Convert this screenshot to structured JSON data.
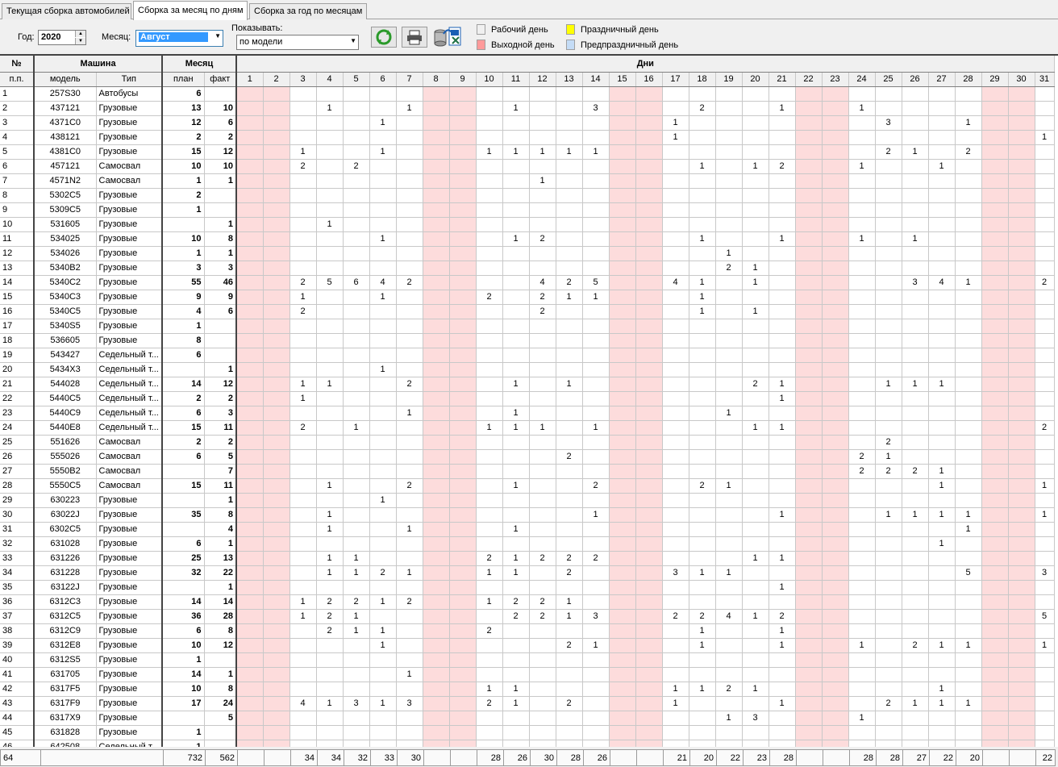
{
  "tabs": [
    {
      "label": "Текущая сборка автомобилей",
      "active": false
    },
    {
      "label": "Сборка за месяц по дням",
      "active": true
    },
    {
      "label": "Сборка за год по месяцам",
      "active": false
    }
  ],
  "toolbar": {
    "year_label": "Год:",
    "year_value": "2020",
    "month_label": "Месяц:",
    "month_value": "Август",
    "show_label": "Показывать:",
    "show_value": "по модели"
  },
  "legend": {
    "work": "Рабочий день",
    "holiday": "Праздничный день",
    "weekend": "Выходной день",
    "preholiday": "Предпраздничный день",
    "colors": {
      "work": "#ffffff",
      "holiday": "#ffff00",
      "weekend": "#ff9a9a",
      "preholiday": "#c4dcf6"
    }
  },
  "headers": {
    "num": "№",
    "machine": "Машина",
    "month": "Месяц",
    "days": "Дни",
    "pp": "п.п.",
    "model": "модель",
    "type": "Тип",
    "plan": "план",
    "fact": "факт"
  },
  "days": [
    "1",
    "2",
    "3",
    "4",
    "5",
    "6",
    "7",
    "8",
    "9",
    "10",
    "11",
    "12",
    "13",
    "14",
    "15",
    "16",
    "17",
    "18",
    "19",
    "20",
    "21",
    "22",
    "23",
    "24",
    "25",
    "26",
    "27",
    "28",
    "29",
    "30",
    "31"
  ],
  "weekend_days": [
    1,
    2,
    8,
    9,
    15,
    16,
    22,
    23,
    29,
    30
  ],
  "rows": [
    {
      "n": "1",
      "model": "257S30",
      "type": "Автобусы",
      "plan": "6",
      "fact": "",
      "d": {}
    },
    {
      "n": "2",
      "model": "437121",
      "type": "Грузовые",
      "plan": "13",
      "fact": "10",
      "d": {
        "4": "1",
        "7": "1",
        "11": "1",
        "14": "3",
        "18": "2",
        "21": "1",
        "24": "1"
      }
    },
    {
      "n": "3",
      "model": "4371C0",
      "type": "Грузовые",
      "plan": "12",
      "fact": "6",
      "d": {
        "6": "1",
        "17": "1",
        "25": "3",
        "28": "1"
      }
    },
    {
      "n": "4",
      "model": "438121",
      "type": "Грузовые",
      "plan": "2",
      "fact": "2",
      "d": {
        "17": "1",
        "31": "1"
      }
    },
    {
      "n": "5",
      "model": "4381C0",
      "type": "Грузовые",
      "plan": "15",
      "fact": "12",
      "d": {
        "3": "1",
        "6": "1",
        "10": "1",
        "11": "1",
        "12": "1",
        "13": "1",
        "14": "1",
        "25": "2",
        "26": "1",
        "28": "2"
      }
    },
    {
      "n": "6",
      "model": "457121",
      "type": "Самосвал",
      "plan": "10",
      "fact": "10",
      "d": {
        "3": "2",
        "5": "2",
        "18": "1",
        "20": "1",
        "21": "2",
        "24": "1",
        "27": "1"
      }
    },
    {
      "n": "7",
      "model": "4571N2",
      "type": "Самосвал",
      "plan": "1",
      "fact": "1",
      "d": {
        "12": "1"
      }
    },
    {
      "n": "8",
      "model": "5302C5",
      "type": "Грузовые",
      "plan": "2",
      "fact": "",
      "d": {}
    },
    {
      "n": "9",
      "model": "5309C5",
      "type": "Грузовые",
      "plan": "1",
      "fact": "",
      "d": {}
    },
    {
      "n": "10",
      "model": "531605",
      "type": "Грузовые",
      "plan": "",
      "fact": "1",
      "d": {
        "4": "1"
      }
    },
    {
      "n": "11",
      "model": "534025",
      "type": "Грузовые",
      "plan": "10",
      "fact": "8",
      "d": {
        "6": "1",
        "11": "1",
        "12": "2",
        "18": "1",
        "21": "1",
        "24": "1",
        "26": "1"
      }
    },
    {
      "n": "12",
      "model": "534026",
      "type": "Грузовые",
      "plan": "1",
      "fact": "1",
      "d": {
        "19": "1"
      }
    },
    {
      "n": "13",
      "model": "5340B2",
      "type": "Грузовые",
      "plan": "3",
      "fact": "3",
      "d": {
        "19": "2",
        "20": "1"
      }
    },
    {
      "n": "14",
      "model": "5340C2",
      "type": "Грузовые",
      "plan": "55",
      "fact": "46",
      "d": {
        "3": "2",
        "4": "5",
        "5": "6",
        "6": "4",
        "7": "2",
        "12": "4",
        "13": "2",
        "14": "5",
        "17": "4",
        "18": "1",
        "20": "1",
        "26": "3",
        "27": "4",
        "28": "1",
        "31": "2"
      }
    },
    {
      "n": "15",
      "model": "5340C3",
      "type": "Грузовые",
      "plan": "9",
      "fact": "9",
      "d": {
        "3": "1",
        "6": "1",
        "10": "2",
        "12": "2",
        "13": "1",
        "14": "1",
        "18": "1"
      }
    },
    {
      "n": "16",
      "model": "5340C5",
      "type": "Грузовые",
      "plan": "4",
      "fact": "6",
      "d": {
        "3": "2",
        "12": "2",
        "18": "1",
        "20": "1"
      }
    },
    {
      "n": "17",
      "model": "5340S5",
      "type": "Грузовые",
      "plan": "1",
      "fact": "",
      "d": {}
    },
    {
      "n": "18",
      "model": "536605",
      "type": "Грузовые",
      "plan": "8",
      "fact": "",
      "d": {}
    },
    {
      "n": "19",
      "model": "543427",
      "type": "Седельный т...",
      "plan": "6",
      "fact": "",
      "d": {}
    },
    {
      "n": "20",
      "model": "5434X3",
      "type": "Седельный т...",
      "plan": "",
      "fact": "1",
      "d": {
        "6": "1"
      }
    },
    {
      "n": "21",
      "model": "544028",
      "type": "Седельный т...",
      "plan": "14",
      "fact": "12",
      "d": {
        "3": "1",
        "4": "1",
        "7": "2",
        "11": "1",
        "13": "1",
        "20": "2",
        "21": "1",
        "25": "1",
        "26": "1",
        "27": "1"
      }
    },
    {
      "n": "22",
      "model": "5440C5",
      "type": "Седельный т...",
      "plan": "2",
      "fact": "2",
      "d": {
        "3": "1",
        "21": "1"
      }
    },
    {
      "n": "23",
      "model": "5440C9",
      "type": "Седельный т...",
      "plan": "6",
      "fact": "3",
      "d": {
        "7": "1",
        "11": "1",
        "19": "1"
      }
    },
    {
      "n": "24",
      "model": "5440E8",
      "type": "Седельный т...",
      "plan": "15",
      "fact": "11",
      "d": {
        "3": "2",
        "5": "1",
        "10": "1",
        "11": "1",
        "12": "1",
        "14": "1",
        "20": "1",
        "21": "1",
        "31": "2"
      }
    },
    {
      "n": "25",
      "model": "551626",
      "type": "Самосвал",
      "plan": "2",
      "fact": "2",
      "d": {
        "25": "2"
      }
    },
    {
      "n": "26",
      "model": "555026",
      "type": "Самосвал",
      "plan": "6",
      "fact": "5",
      "d": {
        "13": "2",
        "24": "2",
        "25": "1"
      }
    },
    {
      "n": "27",
      "model": "5550B2",
      "type": "Самосвал",
      "plan": "",
      "fact": "7",
      "d": {
        "24": "2",
        "25": "2",
        "26": "2",
        "27": "1"
      }
    },
    {
      "n": "28",
      "model": "5550C5",
      "type": "Самосвал",
      "plan": "15",
      "fact": "11",
      "d": {
        "4": "1",
        "7": "2",
        "11": "1",
        "14": "2",
        "18": "2",
        "19": "1",
        "27": "1",
        "31": "1"
      }
    },
    {
      "n": "29",
      "model": "630223",
      "type": "Грузовые",
      "plan": "",
      "fact": "1",
      "d": {
        "6": "1"
      }
    },
    {
      "n": "30",
      "model": "63022J",
      "type": "Грузовые",
      "plan": "35",
      "fact": "8",
      "d": {
        "4": "1",
        "14": "1",
        "21": "1",
        "25": "1",
        "26": "1",
        "27": "1",
        "28": "1",
        "31": "1"
      }
    },
    {
      "n": "31",
      "model": "6302C5",
      "type": "Грузовые",
      "plan": "",
      "fact": "4",
      "d": {
        "4": "1",
        "7": "1",
        "11": "1",
        "28": "1"
      }
    },
    {
      "n": "32",
      "model": "631028",
      "type": "Грузовые",
      "plan": "6",
      "fact": "1",
      "d": {
        "27": "1"
      }
    },
    {
      "n": "33",
      "model": "631226",
      "type": "Грузовые",
      "plan": "25",
      "fact": "13",
      "d": {
        "4": "1",
        "5": "1",
        "10": "2",
        "11": "1",
        "12": "2",
        "13": "2",
        "14": "2",
        "20": "1",
        "21": "1"
      }
    },
    {
      "n": "34",
      "model": "631228",
      "type": "Грузовые",
      "plan": "32",
      "fact": "22",
      "d": {
        "4": "1",
        "5": "1",
        "6": "2",
        "7": "1",
        "10": "1",
        "11": "1",
        "13": "2",
        "17": "3",
        "18": "1",
        "19": "1",
        "28": "5",
        "31": "3"
      }
    },
    {
      "n": "35",
      "model": "63122J",
      "type": "Грузовые",
      "plan": "",
      "fact": "1",
      "d": {
        "21": "1"
      }
    },
    {
      "n": "36",
      "model": "6312C3",
      "type": "Грузовые",
      "plan": "14",
      "fact": "14",
      "d": {
        "3": "1",
        "4": "2",
        "5": "2",
        "6": "1",
        "7": "2",
        "10": "1",
        "11": "2",
        "12": "2",
        "13": "1"
      }
    },
    {
      "n": "37",
      "model": "6312C5",
      "type": "Грузовые",
      "plan": "36",
      "fact": "28",
      "d": {
        "3": "1",
        "4": "2",
        "5": "1",
        "11": "2",
        "12": "2",
        "13": "1",
        "14": "3",
        "17": "2",
        "18": "2",
        "19": "4",
        "20": "1",
        "21": "2",
        "31": "5"
      }
    },
    {
      "n": "38",
      "model": "6312C9",
      "type": "Грузовые",
      "plan": "6",
      "fact": "8",
      "d": {
        "4": "2",
        "5": "1",
        "6": "1",
        "10": "2",
        "18": "1",
        "21": "1"
      }
    },
    {
      "n": "39",
      "model": "6312E8",
      "type": "Грузовые",
      "plan": "10",
      "fact": "12",
      "d": {
        "6": "1",
        "13": "2",
        "14": "1",
        "18": "1",
        "21": "1",
        "24": "1",
        "26": "2",
        "27": "1",
        "28": "1",
        "31": "1"
      }
    },
    {
      "n": "40",
      "model": "6312S5",
      "type": "Грузовые",
      "plan": "1",
      "fact": "",
      "d": {}
    },
    {
      "n": "41",
      "model": "631705",
      "type": "Грузовые",
      "plan": "14",
      "fact": "1",
      "d": {
        "7": "1"
      }
    },
    {
      "n": "42",
      "model": "6317F5",
      "type": "Грузовые",
      "plan": "10",
      "fact": "8",
      "d": {
        "10": "1",
        "11": "1",
        "17": "1",
        "18": "1",
        "19": "2",
        "20": "1",
        "27": "1"
      }
    },
    {
      "n": "43",
      "model": "6317F9",
      "type": "Грузовые",
      "plan": "17",
      "fact": "24",
      "d": {
        "3": "4",
        "4": "1",
        "5": "3",
        "6": "1",
        "7": "3",
        "10": "2",
        "11": "1",
        "13": "2",
        "17": "1",
        "21": "1",
        "25": "2",
        "26": "1",
        "27": "1",
        "28": "1"
      }
    },
    {
      "n": "44",
      "model": "6317X9",
      "type": "Грузовые",
      "plan": "",
      "fact": "5",
      "d": {
        "19": "1",
        "20": "3",
        "24": "1"
      }
    },
    {
      "n": "45",
      "model": "631828",
      "type": "Грузовые",
      "plan": "1",
      "fact": "",
      "d": {}
    },
    {
      "n": "46",
      "model": "642508",
      "type": "Седельный т...",
      "plan": "1",
      "fact": "",
      "d": {}
    }
  ],
  "footer": {
    "count": "64",
    "plan_total": "732",
    "fact_total": "562",
    "day_totals": [
      "",
      "",
      "34",
      "34",
      "32",
      "33",
      "30",
      "",
      "",
      "28",
      "26",
      "30",
      "28",
      "26",
      "",
      "",
      "21",
      "20",
      "22",
      "23",
      "28",
      "",
      "",
      "28",
      "28",
      "27",
      "22",
      "20",
      "",
      "",
      "22"
    ]
  }
}
